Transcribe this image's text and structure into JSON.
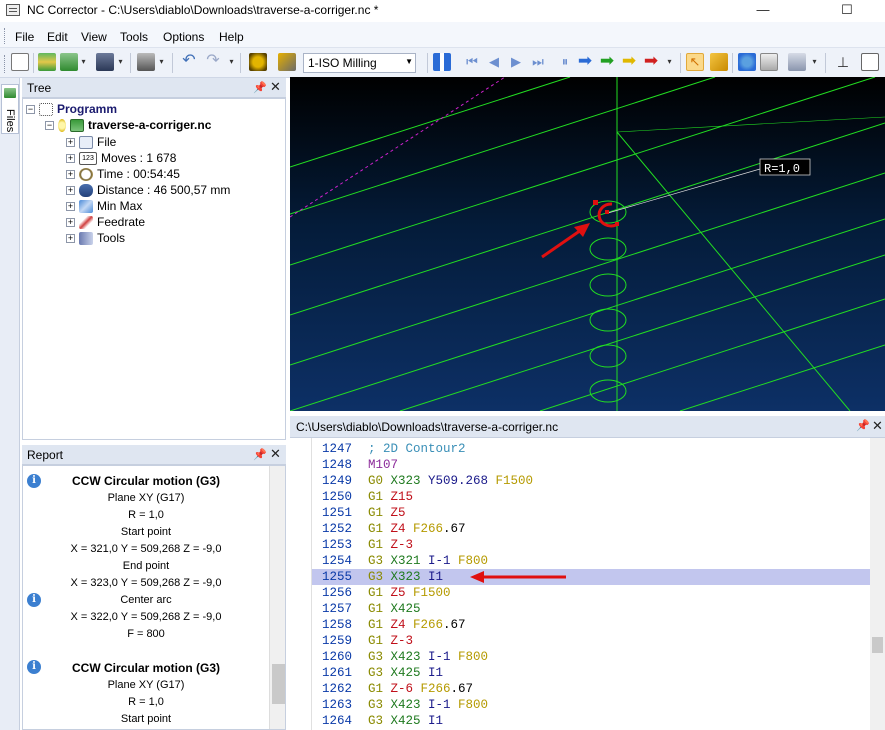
{
  "window": {
    "title": "NC Corrector - C:\\Users\\diablo\\Downloads\\traverse-a-corriger.nc *",
    "minimize_glyph": "—",
    "maximize_glyph": "☐"
  },
  "menu": [
    "File",
    "Edit",
    "View",
    "Tools",
    "Options",
    "Help"
  ],
  "toolbar": {
    "machine_mode": "1-ISO Milling"
  },
  "files_tab": {
    "label": "Files"
  },
  "tree": {
    "title": "Tree",
    "root": "Programm",
    "file": "traverse-a-corriger.nc",
    "items": [
      {
        "icon": "file-info-icon",
        "label": "File"
      },
      {
        "icon": "counter-icon",
        "label": "Moves : 1 678"
      },
      {
        "icon": "clock-icon",
        "label": "Time : 00:54:45"
      },
      {
        "icon": "distance-icon",
        "label": "Distance : 46 500,57 mm"
      },
      {
        "icon": "minmax-icon",
        "label": "Min Max"
      },
      {
        "icon": "feedrate-icon",
        "label": "Feedrate"
      },
      {
        "icon": "tools-icon",
        "label": "Tools"
      }
    ],
    "counter_badge": "123"
  },
  "report": {
    "title": "Report",
    "lines": [
      {
        "text": "CCW Circular motion (G3)",
        "bold": true
      },
      {
        "text": "Plane XY (G17)",
        "bold": false
      },
      {
        "text": "R = 1,0",
        "bold": false
      },
      {
        "text": "Start point",
        "bold": false
      },
      {
        "text": "X = 321,0 Y = 509,268 Z = -9,0",
        "bold": false
      },
      {
        "text": "End point",
        "bold": false
      },
      {
        "text": "X = 323,0 Y = 509,268 Z = -9,0",
        "bold": false
      },
      {
        "text": "Center arc",
        "bold": false
      },
      {
        "text": "X = 322,0 Y = 509,268 Z = -9,0",
        "bold": false
      },
      {
        "text": "F = 800",
        "bold": false
      },
      {
        "text": "",
        "bold": false
      },
      {
        "text": "CCW Circular motion (G3)",
        "bold": true
      },
      {
        "text": "Plane XY (G17)",
        "bold": false
      },
      {
        "text": "R = 1,0",
        "bold": false
      },
      {
        "text": "Start point",
        "bold": false
      }
    ],
    "info_glyph": "i"
  },
  "viewport": {
    "radius_label": "R=1,0"
  },
  "editor": {
    "path": "C:\\Users\\diablo\\Downloads\\traverse-a-corriger.nc",
    "highlighted_line": 1255,
    "lines": [
      {
        "n": "1247",
        "tokens": [
          [
            "comment",
            "; 2D Contour2"
          ]
        ]
      },
      {
        "n": "1248",
        "tokens": [
          [
            "m",
            "M107"
          ]
        ]
      },
      {
        "n": "1249",
        "tokens": [
          [
            "g",
            "G0"
          ],
          [
            "x",
            " X323"
          ],
          [
            "y",
            " Y509.268"
          ],
          [
            "f",
            " F1500"
          ]
        ]
      },
      {
        "n": "1250",
        "tokens": [
          [
            "g",
            "G1"
          ],
          [
            "z",
            " Z15"
          ]
        ]
      },
      {
        "n": "1251",
        "tokens": [
          [
            "g",
            "G1"
          ],
          [
            "z",
            " Z5"
          ]
        ]
      },
      {
        "n": "1252",
        "tokens": [
          [
            "g",
            "G1"
          ],
          [
            "z",
            " Z4"
          ],
          [
            "f",
            " F266"
          ],
          [
            "n",
            ".67"
          ]
        ]
      },
      {
        "n": "1253",
        "tokens": [
          [
            "g",
            "G1"
          ],
          [
            "z",
            " Z-3"
          ]
        ]
      },
      {
        "n": "1254",
        "tokens": [
          [
            "g",
            "G3"
          ],
          [
            "x",
            " X321"
          ],
          [
            "i",
            " I-1"
          ],
          [
            "f",
            " F800"
          ]
        ]
      },
      {
        "n": "1255",
        "tokens": [
          [
            "g",
            "G3"
          ],
          [
            "x",
            " X323"
          ],
          [
            "i",
            " I1"
          ]
        ]
      },
      {
        "n": "1256",
        "tokens": [
          [
            "g",
            "G1"
          ],
          [
            "z",
            " Z5"
          ],
          [
            "f",
            " F1500"
          ]
        ]
      },
      {
        "n": "1257",
        "tokens": [
          [
            "g",
            "G1"
          ],
          [
            "x",
            " X425"
          ]
        ]
      },
      {
        "n": "1258",
        "tokens": [
          [
            "g",
            "G1"
          ],
          [
            "z",
            " Z4"
          ],
          [
            "f",
            " F266"
          ],
          [
            "n",
            ".67"
          ]
        ]
      },
      {
        "n": "1259",
        "tokens": [
          [
            "g",
            "G1"
          ],
          [
            "z",
            " Z-3"
          ]
        ]
      },
      {
        "n": "1260",
        "tokens": [
          [
            "g",
            "G3"
          ],
          [
            "x",
            " X423"
          ],
          [
            "i",
            " I-1"
          ],
          [
            "f",
            " F800"
          ]
        ]
      },
      {
        "n": "1261",
        "tokens": [
          [
            "g",
            "G3"
          ],
          [
            "x",
            " X425"
          ],
          [
            "i",
            " I1"
          ]
        ]
      },
      {
        "n": "1262",
        "tokens": [
          [
            "g",
            "G1"
          ],
          [
            "z",
            " Z-6"
          ],
          [
            "f",
            " F266"
          ],
          [
            "n",
            ".67"
          ]
        ]
      },
      {
        "n": "1263",
        "tokens": [
          [
            "g",
            "G3"
          ],
          [
            "x",
            " X423"
          ],
          [
            "i",
            " I-1"
          ],
          [
            "f",
            " F800"
          ]
        ]
      },
      {
        "n": "1264",
        "tokens": [
          [
            "g",
            "G3"
          ],
          [
            "x",
            " X425"
          ],
          [
            "i",
            " I1"
          ]
        ]
      }
    ]
  },
  "colors": {
    "toolpath": "#22dd22",
    "rapid": "#cc22cc",
    "annotation": "#e01010",
    "highlight": "#c2c6ee"
  }
}
